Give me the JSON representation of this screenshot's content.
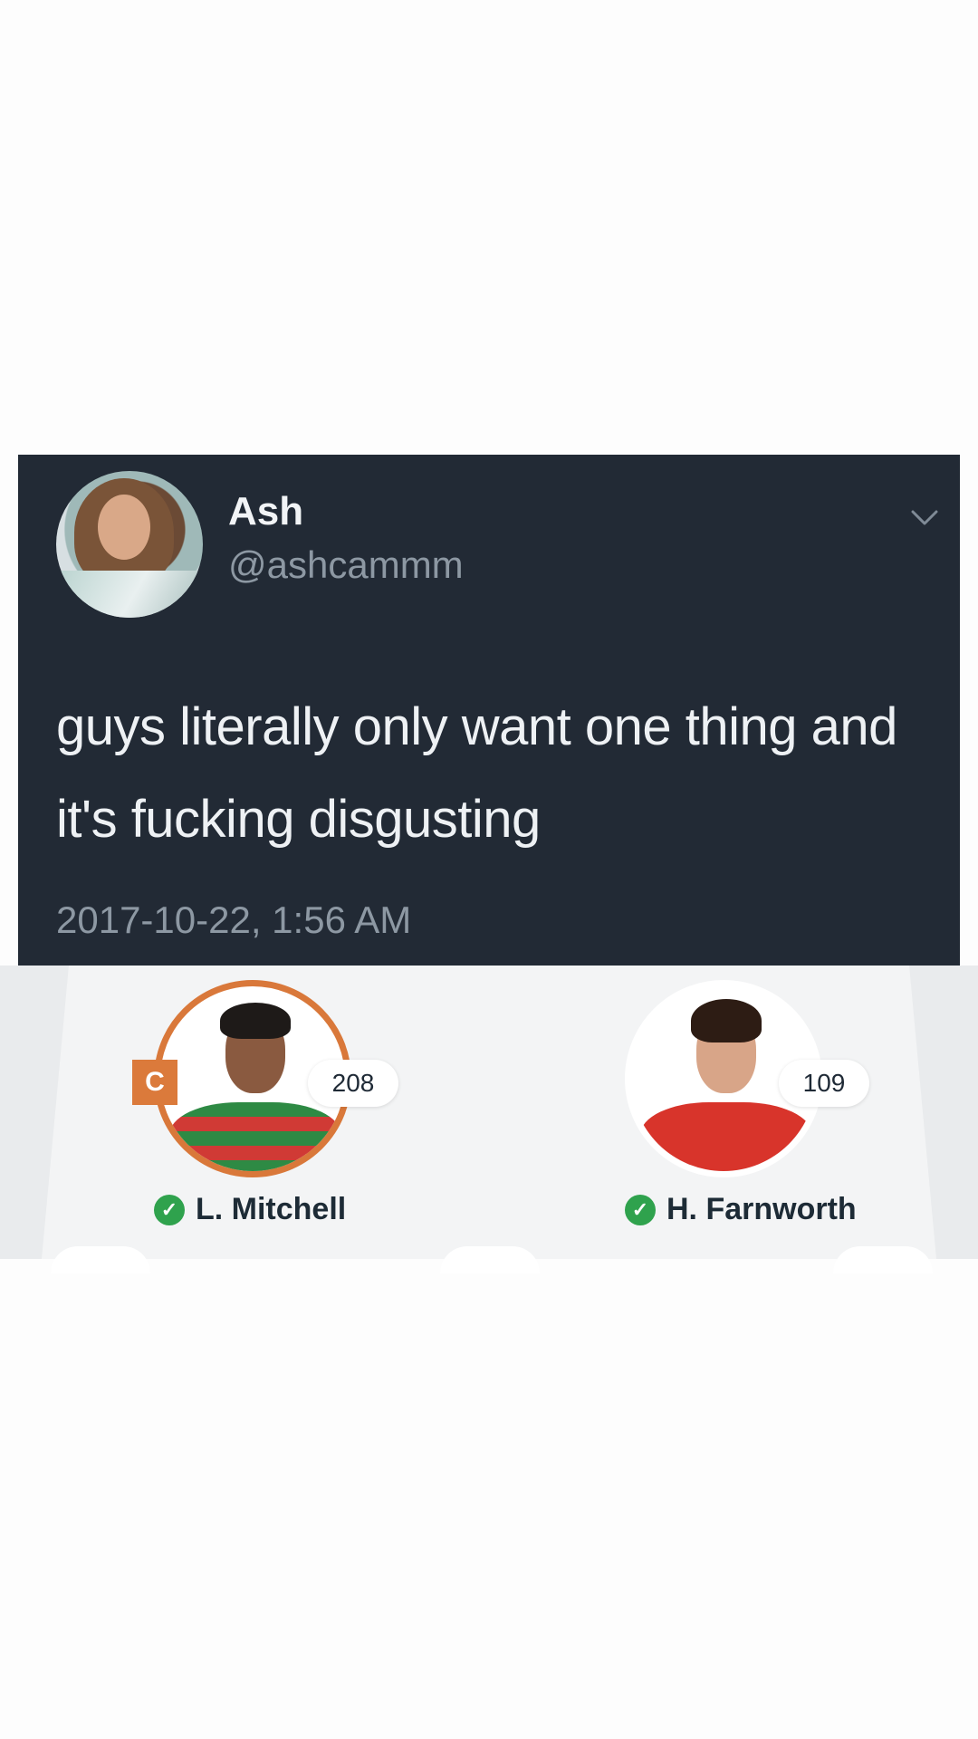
{
  "tweet": {
    "display_name": "Ash",
    "handle": "@ashcammm",
    "text": "guys literally only want one thing and it's fucking disgusting",
    "timestamp": "2017-10-22, 1:56 AM",
    "icons": {
      "menu": "chevron-down-icon"
    }
  },
  "team": {
    "players": [
      {
        "name": "L. Mitchell",
        "score": "208",
        "captain_badge": "C",
        "status_icon": "check-circle-icon"
      },
      {
        "name": "H. Farnworth",
        "score": "109",
        "status_icon": "check-circle-icon"
      }
    ]
  },
  "colors": {
    "tweet_bg": "#222a35",
    "captain_accent": "#db7a3b",
    "status_green": "#2fa24d"
  }
}
